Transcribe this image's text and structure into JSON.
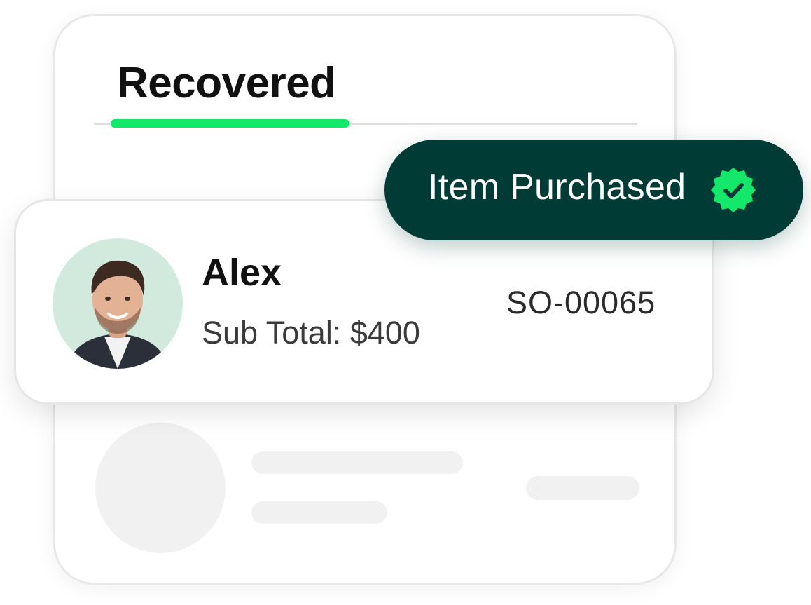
{
  "tabs": {
    "active_label": "Recovered"
  },
  "badge": {
    "label": "Item Purchased",
    "icon": "verified-check-icon",
    "background": "#003b35",
    "icon_color": "#14e86a"
  },
  "record": {
    "name": "Alex",
    "subtotal": "Sub Total: $400",
    "order_id": "SO-00065",
    "avatar_background": "#d2eade"
  },
  "colors": {
    "accent": "#14e86a",
    "badge_bg": "#003b35"
  }
}
